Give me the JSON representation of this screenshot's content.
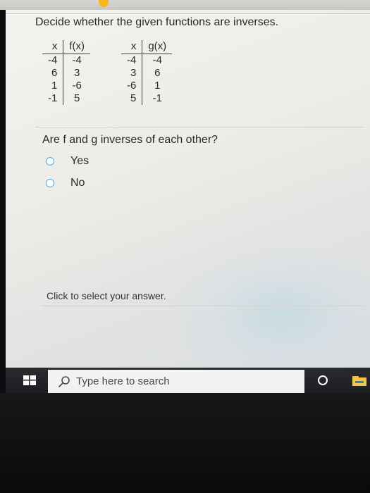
{
  "question": "Decide whether the given functions are inverses.",
  "table_f": {
    "headers": [
      "x",
      "f(x)"
    ],
    "rows": [
      [
        "-4",
        "-4"
      ],
      [
        "6",
        "3"
      ],
      [
        "1",
        "-6"
      ],
      [
        "-1",
        "5"
      ]
    ]
  },
  "table_g": {
    "headers": [
      "x",
      "g(x)"
    ],
    "rows": [
      [
        "-4",
        "-4"
      ],
      [
        "3",
        "6"
      ],
      [
        "-6",
        "1"
      ],
      [
        "5",
        "-1"
      ]
    ]
  },
  "prompt": "Are f and g inverses of each other?",
  "options": [
    {
      "label": "Yes"
    },
    {
      "label": "No"
    }
  ],
  "hint": "Click to select your answer.",
  "taskbar": {
    "search_placeholder": "Type here to search",
    "icons": [
      "windows-start-icon",
      "search-icon",
      "cortana-icon",
      "file-explorer-icon"
    ]
  },
  "colors": {
    "radio_border": "#4aa9e0",
    "taskbar": "#1f2024",
    "searchbox": "#f2f2f2"
  }
}
